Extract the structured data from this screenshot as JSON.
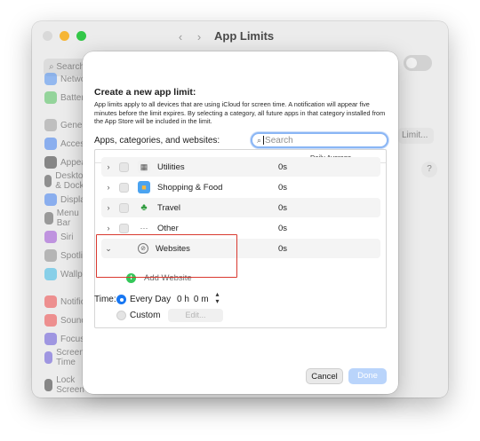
{
  "window": {
    "title": "App Limits",
    "back_glyph": "‹",
    "forward_glyph": "›"
  },
  "sidebar": {
    "search_placeholder": "Search",
    "items": [
      {
        "label": "Network",
        "color": "#4a8ef3"
      },
      {
        "label": "Battery",
        "color": "#4cc15a"
      },
      {
        "label": "General",
        "color": "#9a9a9a"
      },
      {
        "label": "Accessibility",
        "color": "#3a7cf0"
      },
      {
        "label": "Appearance",
        "color": "#333333"
      },
      {
        "label": "Desktop & Dock",
        "color": "#444444"
      },
      {
        "label": "Displays",
        "color": "#3a7cf0"
      },
      {
        "label": "Menu Bar",
        "color": "#555555"
      },
      {
        "label": "Siri",
        "color": "#9a4bd6"
      },
      {
        "label": "Spotlight",
        "color": "#888888"
      },
      {
        "label": "Wallpaper",
        "color": "#35b8e6"
      },
      {
        "label": "Notifications",
        "color": "#ef4444"
      },
      {
        "label": "Sound",
        "color": "#ef4444"
      },
      {
        "label": "Focus",
        "color": "#6150d8"
      },
      {
        "label": "Screen Time",
        "color": "#6150d8"
      },
      {
        "label": "Lock Screen",
        "color": "#333333"
      }
    ]
  },
  "background": {
    "limit_button": "Limit...",
    "help": "?"
  },
  "sheet": {
    "title": "Create a new app limit:",
    "description": "App limits apply to all devices that are using iCloud for screen time. A notification will appear five minutes before the limit expires. By selecting a category, all future apps in that category installed from the App Store will be included in the limit.",
    "list_label": "Apps, categories, and websites:",
    "search": {
      "placeholder": "Search",
      "value": ""
    },
    "column_header": "Daily Average",
    "rows": [
      {
        "name": "Utilities",
        "value": "0s",
        "chevron": "›",
        "icon": "utilities-icon"
      },
      {
        "name": "Shopping & Food",
        "value": "0s",
        "chevron": "›",
        "icon": "shopping-bag-icon"
      },
      {
        "name": "Travel",
        "value": "0s",
        "chevron": "›",
        "icon": "palm-tree-icon"
      },
      {
        "name": "Other",
        "value": "0s",
        "chevron": "›",
        "icon": "ellipsis-icon"
      },
      {
        "name": "Websites",
        "value": "0s",
        "chevron": "⌄",
        "icon": "compass-icon"
      }
    ],
    "add_website": "Add Website",
    "time_label": "Time:",
    "every_day": "Every Day",
    "custom": "Custom",
    "hours": "0 h",
    "minutes": "0 m",
    "edit": "Edit...",
    "cancel": "Cancel",
    "done": "Done"
  },
  "colors": {
    "accent": "#1877f2",
    "highlight_box": "#d9392f",
    "add_green": "#34c759",
    "done_disabled": "#b9d4fb"
  }
}
